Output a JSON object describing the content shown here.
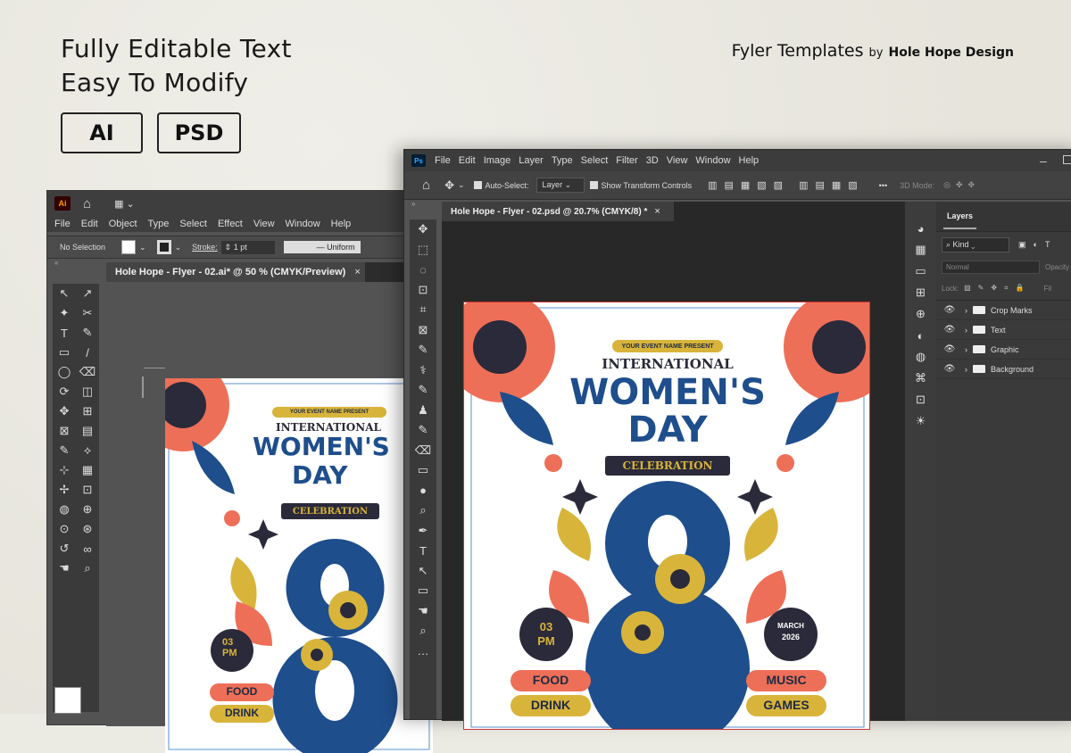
{
  "headline": {
    "line1": "Fully Editable Text",
    "line2": "Easy To Modify"
  },
  "badges": {
    "ai": "AI",
    "psd": "PSD"
  },
  "brand": {
    "name": "Fyler Templates",
    "by": "by",
    "studio": "Hole Hope Design"
  },
  "illustrator": {
    "logo": "Ai",
    "menu": [
      "File",
      "Edit",
      "Object",
      "Type",
      "Select",
      "Effect",
      "View",
      "Window",
      "Help"
    ],
    "control": {
      "selection": "No Selection",
      "stroke_label": "Stroke:",
      "stroke_value": "1 pt",
      "stroke_style": "Uniform"
    },
    "tab": "Hole Hope - Flyer - 02.ai* @ 50 % (CMYK/Preview)",
    "close": "×"
  },
  "photoshop": {
    "logo": "Ps",
    "menu": [
      "File",
      "Edit",
      "Image",
      "Layer",
      "Type",
      "Select",
      "Filter",
      "3D",
      "View",
      "Window",
      "Help"
    ],
    "options": {
      "auto_select": "Auto-Select:",
      "layer": "Layer",
      "transform": "Show Transform Controls",
      "mode3d": "3D Mode:"
    },
    "tab": "Hole Hope - Flyer - 02.psd @ 20.7% (CMYK/8) *",
    "close": "×",
    "layers": {
      "title": "Layers",
      "kind": "Kind",
      "blend": "Normal",
      "opacity": "Opacity",
      "lock": "Lock:",
      "fill": "Fil",
      "items": [
        "Crop Marks",
        "Text",
        "Graphic",
        "Background"
      ]
    }
  },
  "flyer": {
    "event_name": "YOUR EVENT NAME PRESENT",
    "international": "INTERNATIONAL",
    "womens": "WOMEN'S",
    "day": "DAY",
    "celebration": "CELEBRATION",
    "big_number": "8",
    "date_day": "03",
    "date_month": "PM",
    "march": "MARCH",
    "year": "2026",
    "left_items": [
      "FOOD",
      "DRINK"
    ],
    "right_items": [
      "MUSIC",
      "GAMES"
    ]
  },
  "colors": {
    "navy": "#1e4e8c",
    "coral": "#ee6f57",
    "mustard": "#d8b43a",
    "dark": "#2a2a3a"
  }
}
